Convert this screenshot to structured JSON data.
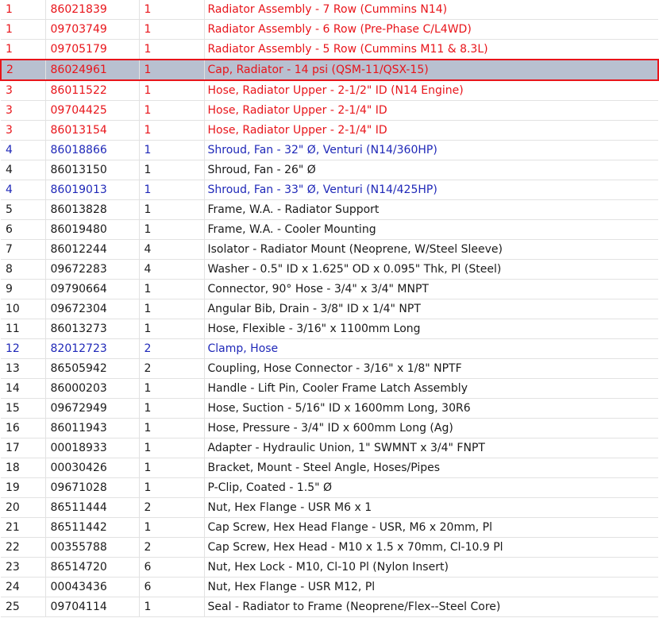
{
  "rows": [
    {
      "ref": "1",
      "pn": "86021839",
      "qty": "1",
      "desc": "Radiator Assembly - 7 Row (Cummins N14)",
      "color": "red"
    },
    {
      "ref": "1",
      "pn": "09703749",
      "qty": "1",
      "desc": "Radiator Assembly - 6 Row (Pre-Phase C/L4WD)",
      "color": "red"
    },
    {
      "ref": "1",
      "pn": "09705179",
      "qty": "1",
      "desc": "Radiator Assembly - 5 Row (Cummins M11 & 8.3L)",
      "color": "red"
    },
    {
      "ref": "2",
      "pn": "86024961",
      "qty": "1",
      "desc": "Cap, Radiator - 14 psi (QSM-11/QSX-15)",
      "color": "red",
      "selected": true
    },
    {
      "ref": "3",
      "pn": "86011522",
      "qty": "1",
      "desc": "Hose, Radiator Upper - 2-1/2\" ID (N14 Engine)",
      "color": "red"
    },
    {
      "ref": "3",
      "pn": "09704425",
      "qty": "1",
      "desc": "Hose, Radiator Upper - 2-1/4\" ID",
      "color": "red"
    },
    {
      "ref": "3",
      "pn": "86013154",
      "qty": "1",
      "desc": "Hose, Radiator Upper - 2-1/4\" ID",
      "color": "red"
    },
    {
      "ref": "4",
      "pn": "86018866",
      "qty": "1",
      "desc": "Shroud, Fan - 32\" Ø, Venturi (N14/360HP)",
      "color": "blue"
    },
    {
      "ref": "4",
      "pn": "86013150",
      "qty": "1",
      "desc": "Shroud, Fan - 26\" Ø",
      "color": "black"
    },
    {
      "ref": "4",
      "pn": "86019013",
      "qty": "1",
      "desc": "Shroud, Fan - 33\" Ø, Venturi (N14/425HP)",
      "color": "blue"
    },
    {
      "ref": "5",
      "pn": "86013828",
      "qty": "1",
      "desc": "Frame, W.A. - Radiator Support",
      "color": "black"
    },
    {
      "ref": "6",
      "pn": "86019480",
      "qty": "1",
      "desc": "Frame, W.A. - Cooler Mounting",
      "color": "black"
    },
    {
      "ref": "7",
      "pn": "86012244",
      "qty": "4",
      "desc": "Isolator - Radiator Mount (Neoprene, W/Steel Sleeve)",
      "color": "black"
    },
    {
      "ref": "8",
      "pn": "09672283",
      "qty": "4",
      "desc": "Washer - 0.5\" ID x 1.625\" OD x 0.095\" Thk, Pl (Steel)",
      "color": "black"
    },
    {
      "ref": "9",
      "pn": "09790664",
      "qty": "1",
      "desc": "Connector, 90° Hose - 3/4\" x 3/4\" MNPT",
      "color": "black"
    },
    {
      "ref": "10",
      "pn": "09672304",
      "qty": "1",
      "desc": "Angular Bib, Drain - 3/8\" ID x 1/4\" NPT",
      "color": "black"
    },
    {
      "ref": "11",
      "pn": "86013273",
      "qty": "1",
      "desc": "Hose, Flexible - 3/16\" x 1100mm Long",
      "color": "black"
    },
    {
      "ref": "12",
      "pn": "82012723",
      "qty": "2",
      "desc": "Clamp, Hose",
      "color": "blue"
    },
    {
      "ref": "13",
      "pn": "86505942",
      "qty": "2",
      "desc": "Coupling, Hose Connector - 3/16\" x 1/8\" NPTF",
      "color": "black"
    },
    {
      "ref": "14",
      "pn": "86000203",
      "qty": "1",
      "desc": "Handle - Lift Pin, Cooler Frame Latch Assembly",
      "color": "black"
    },
    {
      "ref": "15",
      "pn": "09672949",
      "qty": "1",
      "desc": "Hose, Suction - 5/16\" ID x 1600mm Long, 30R6",
      "color": "black"
    },
    {
      "ref": "16",
      "pn": "86011943",
      "qty": "1",
      "desc": "Hose, Pressure - 3/4\" ID x 600mm Long (Ag)",
      "color": "black"
    },
    {
      "ref": "17",
      "pn": "00018933",
      "qty": "1",
      "desc": "Adapter - Hydraulic Union, 1\" SWMNT x 3/4\" FNPT",
      "color": "black"
    },
    {
      "ref": "18",
      "pn": "00030426",
      "qty": "1",
      "desc": "Bracket, Mount - Steel Angle, Hoses/Pipes",
      "color": "black"
    },
    {
      "ref": "19",
      "pn": "09671028",
      "qty": "1",
      "desc": "P-Clip, Coated - 1.5\" Ø",
      "color": "black"
    },
    {
      "ref": "20",
      "pn": "86511444",
      "qty": "2",
      "desc": "Nut, Hex Flange - USR M6 x 1",
      "color": "black"
    },
    {
      "ref": "21",
      "pn": "86511442",
      "qty": "1",
      "desc": "Cap Screw, Hex Head Flange - USR, M6 x 20mm, Pl",
      "color": "black"
    },
    {
      "ref": "22",
      "pn": "00355788",
      "qty": "2",
      "desc": "Cap Screw, Hex Head - M10 x 1.5 x 70mm, Cl-10.9 Pl",
      "color": "black"
    },
    {
      "ref": "23",
      "pn": "86514720",
      "qty": "6",
      "desc": "Nut, Hex Lock - M10, Cl-10 Pl (Nylon Insert)",
      "color": "black"
    },
    {
      "ref": "24",
      "pn": "00043436",
      "qty": "6",
      "desc": "Nut, Hex Flange - USR M12, Pl",
      "color": "black"
    },
    {
      "ref": "25",
      "pn": "09704114",
      "qty": "1",
      "desc": "Seal - Radiator to Frame (Neoprene/Flex--Steel Core)",
      "color": "black"
    }
  ],
  "colors": {
    "red": "#e8141a",
    "blue": "#1f28b8",
    "black": "#1a1a1a",
    "selected_background": "#b8c0d0",
    "gridline": "#e2e2e2"
  }
}
